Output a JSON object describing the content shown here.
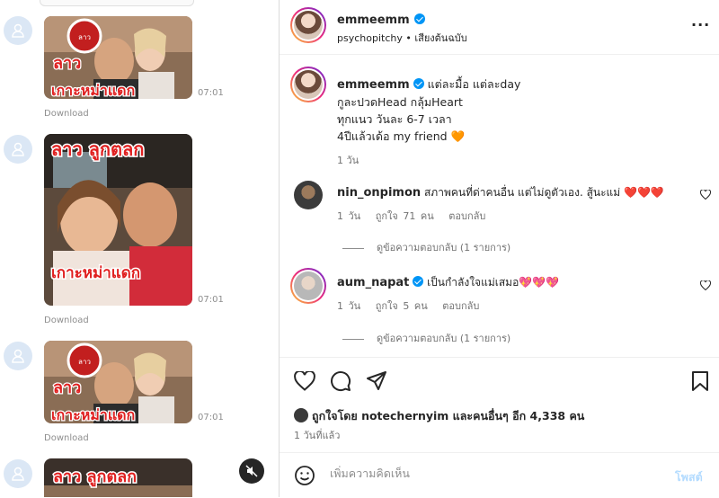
{
  "chat": {
    "messages": [
      {
        "overlay_top": "ลาว",
        "overlay_bottom": "เกาะหม่าแดก",
        "time": "07:01",
        "download": "Download"
      },
      {
        "overlay_top": "ลาว ลูกตลก",
        "overlay_bottom": "เกาะหม่าแดก",
        "time": "07:01",
        "download": "Download"
      },
      {
        "overlay_top": "ลาว",
        "overlay_bottom": "เกาะหม่าแดก",
        "time": "07:01",
        "download": "Download"
      },
      {
        "overlay_top": "ลาว ลูกตลก",
        "overlay_bottom": "",
        "time": "",
        "download": ""
      }
    ]
  },
  "post": {
    "author": "emmeemm",
    "audio": "psychopitchy",
    "audio_sep": "•",
    "audio_label": "เสียงต้นฉบับ",
    "caption": {
      "username": "emmeemm",
      "lines": [
        "แต่ละมื้อ แต่ละday",
        "กูละปวดHead กลุ้มHeart",
        "ทุกแนว วันละ 6-7 เวลา",
        "4ปีแล้วเด้อ my friend 🧡"
      ],
      "time": "1 วัน"
    },
    "comments": [
      {
        "username": "nin_onpimon",
        "text": "สภาพคนที่ด่าคนอื่น แต่ไม่ดูตัวเอง. สู้นะแม่ ❤️❤️❤️",
        "time": "1 วัน",
        "likes": "ถูกใจ 71 คน",
        "reply": "ตอบกลับ",
        "view_replies": "ดูข้อความตอบกลับ (1 รายการ)"
      },
      {
        "username": "aum_napat",
        "text": "เป็นกำลังใจแม่เสมอ💖💖💖",
        "time": "1 วัน",
        "likes": "ถูกใจ 5 คน",
        "reply": "ตอบกลับ",
        "view_replies": "ดูข้อความตอบกลับ (1 รายการ)"
      }
    ],
    "likes_text": "ถูกใจโดย notechernyim และคนอื่นๆ อีก 4,338 คน",
    "likes_user": "notechernyim",
    "posted": "1 วันที่แล้ว",
    "add_comment_placeholder": "เพิ่มความคิดเห็น",
    "post_button": "โพสต์",
    "icons": [
      "heart-icon",
      "comment-icon",
      "share-icon",
      "bookmark-icon",
      "emoji-icon",
      "more-icon",
      "mute-icon"
    ]
  }
}
